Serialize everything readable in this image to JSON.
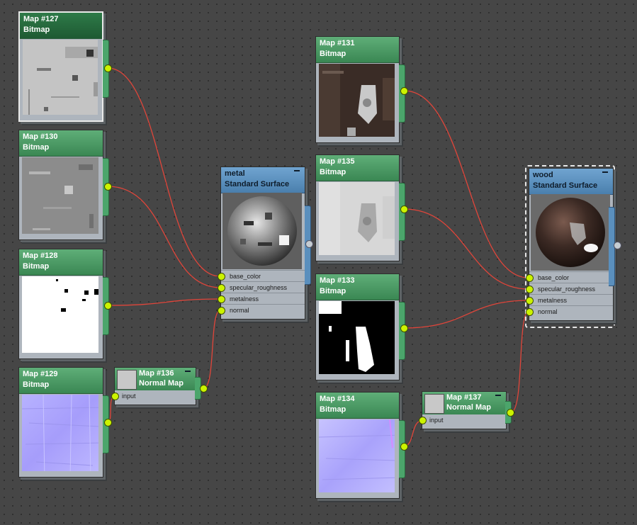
{
  "bitmaps": [
    {
      "id": "map127",
      "title": "Map #127",
      "subtitle": "Bitmap",
      "texture": "grey-metal"
    },
    {
      "id": "map130",
      "title": "Map #130",
      "subtitle": "Bitmap",
      "texture": "dark-grey-metal"
    },
    {
      "id": "map128",
      "title": "Map #128",
      "subtitle": "Bitmap",
      "texture": "white-mask"
    },
    {
      "id": "map129",
      "title": "Map #129",
      "subtitle": "Bitmap",
      "texture": "normal-blue"
    },
    {
      "id": "map131",
      "title": "Map #131",
      "subtitle": "Bitmap",
      "texture": "brown-wood"
    },
    {
      "id": "map135",
      "title": "Map #135",
      "subtitle": "Bitmap",
      "texture": "light-grey"
    },
    {
      "id": "map133",
      "title": "Map #133",
      "subtitle": "Bitmap",
      "texture": "black-mask"
    },
    {
      "id": "map134",
      "title": "Map #134",
      "subtitle": "Bitmap",
      "texture": "normal-blue"
    }
  ],
  "normal_maps": [
    {
      "id": "map136",
      "title": "Map #136",
      "subtitle": "Normal Map",
      "slot": "input"
    },
    {
      "id": "map137",
      "title": "Map #137",
      "subtitle": "Normal Map",
      "slot": "input"
    }
  ],
  "materials": [
    {
      "id": "metal",
      "title": "metal",
      "subtitle": "Standard Surface",
      "slots": [
        "base_color",
        "specular_roughness",
        "metalness",
        "normal"
      ]
    },
    {
      "id": "wood",
      "title": "wood",
      "subtitle": "Standard Surface",
      "slots": [
        "base_color",
        "specular_roughness",
        "metalness",
        "normal"
      ]
    }
  ],
  "colors": {
    "wire": "#e0453a",
    "port": "#ccf300",
    "bitmap_header": "#4b9b64",
    "material_header": "#5e93c2"
  }
}
